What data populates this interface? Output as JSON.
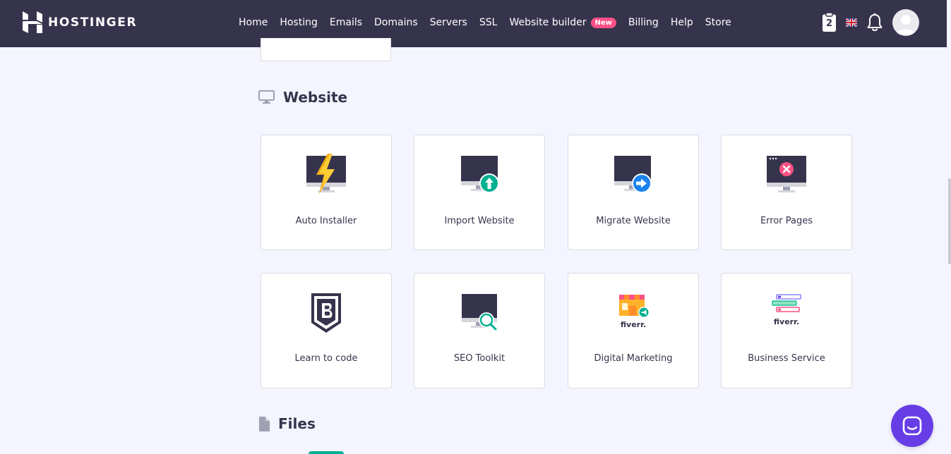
{
  "brand": {
    "name": "HOSTINGER",
    "logo_icon": "hostinger-logo-icon"
  },
  "nav": {
    "items": [
      {
        "label": "Home"
      },
      {
        "label": "Hosting"
      },
      {
        "label": "Emails"
      },
      {
        "label": "Domains"
      },
      {
        "label": "Servers"
      },
      {
        "label": "SSL"
      },
      {
        "label": "Website builder",
        "badge": "New"
      },
      {
        "label": "Billing"
      },
      {
        "label": "Help"
      },
      {
        "label": "Store"
      }
    ]
  },
  "toolbar": {
    "cart_count": "2",
    "cart_icon": "clipboard-icon",
    "language_icon": "uk-flag-icon",
    "notifications_icon": "bell-icon",
    "avatar_icon": "user-avatar-icon"
  },
  "sections": {
    "website": {
      "title": "Website",
      "icon": "monitor-icon",
      "cards": [
        {
          "label": "Auto Installer",
          "icon": "auto-installer-icon"
        },
        {
          "label": "Import Website",
          "icon": "import-website-icon"
        },
        {
          "label": "Migrate Website",
          "icon": "migrate-website-icon"
        },
        {
          "label": "Error Pages",
          "icon": "error-pages-icon"
        },
        {
          "label": "Learn to code",
          "icon": "learn-to-code-icon"
        },
        {
          "label": "SEO Toolkit",
          "icon": "seo-toolkit-icon"
        },
        {
          "label": "Digital Marketing",
          "icon": "fiverr-marketing-icon",
          "icon_text": "fiverr."
        },
        {
          "label": "Business Service",
          "icon": "fiverr-business-icon",
          "icon_text": "fiverr."
        }
      ]
    },
    "files": {
      "title": "Files",
      "icon": "file-icon"
    }
  },
  "chat": {
    "icon": "chat-icon"
  },
  "colors": {
    "topbar": "#36344d",
    "background": "#f4f5ff",
    "accent": "#673de6",
    "badge": "#fc5185",
    "success": "#00b090",
    "info": "#1a82ed",
    "danger": "#fc5185"
  }
}
